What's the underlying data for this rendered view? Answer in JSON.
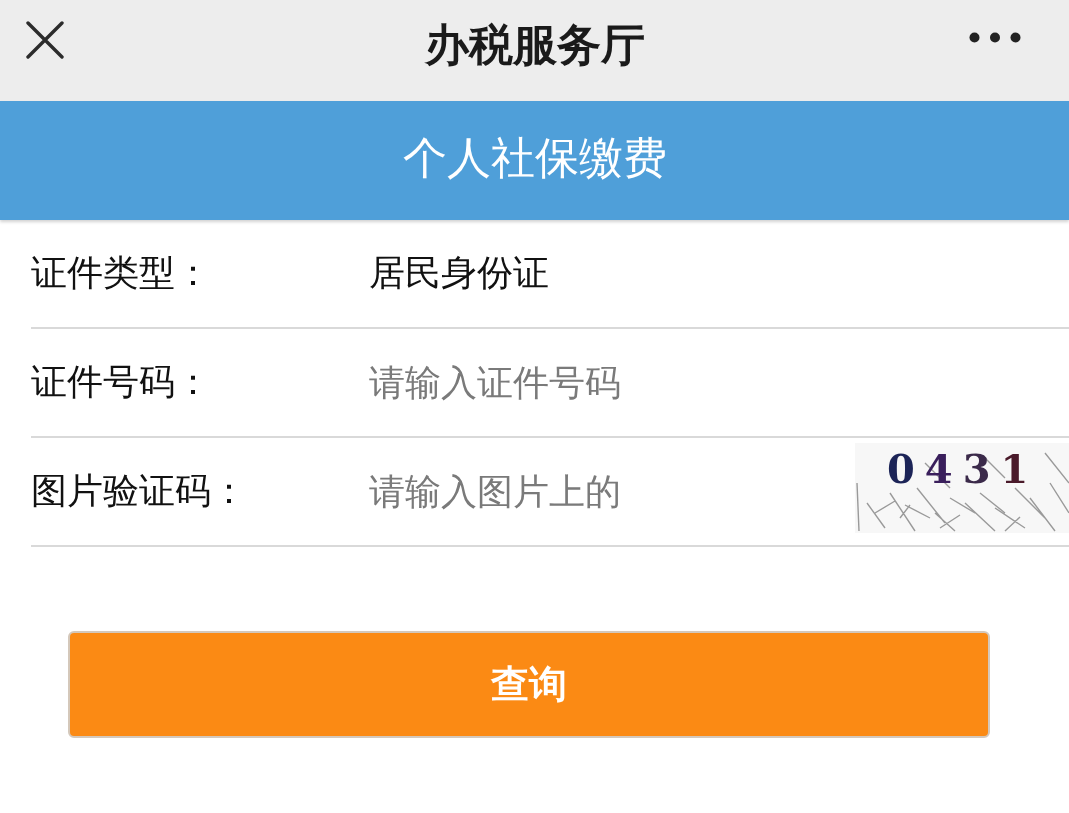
{
  "nav_bar": {
    "title": "办税服务厅"
  },
  "page_header": {
    "title": "个人社保缴费"
  },
  "form": {
    "rows": [
      {
        "kind": "value",
        "label": "证件类型：",
        "value": "居民身份证"
      },
      {
        "kind": "input",
        "label": "证件号码：",
        "placeholder": "请输入证件号码"
      },
      {
        "kind": "captcha",
        "label": "图片验证码：",
        "placeholder": "请输入图片上的",
        "captcha_text": "0431"
      }
    ]
  },
  "buttons": [
    {
      "label": "查询"
    }
  ]
}
